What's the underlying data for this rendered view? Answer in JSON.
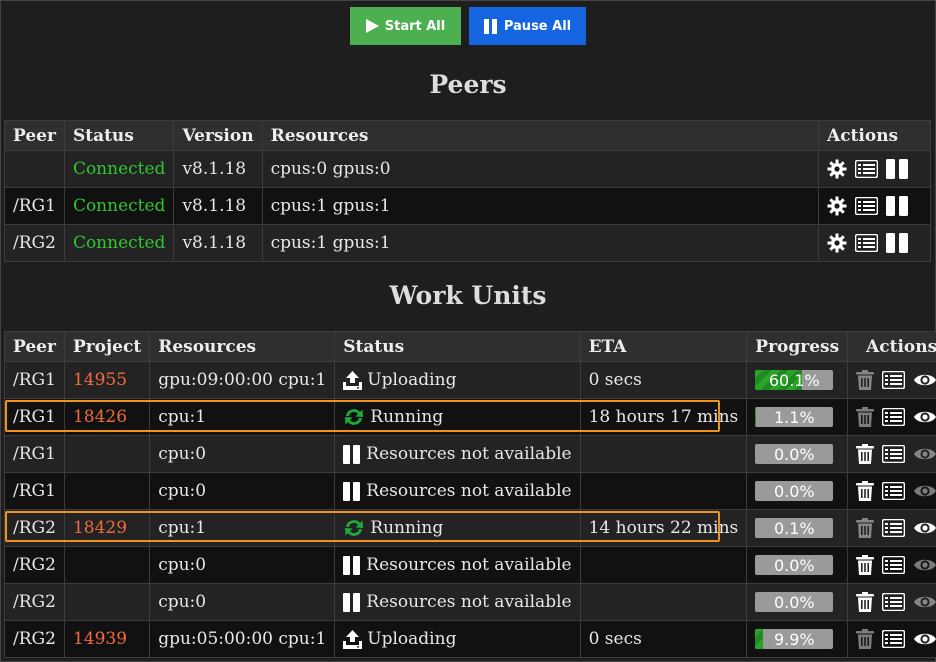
{
  "top_buttons": {
    "start_label": "Start All",
    "pause_label": "Pause All"
  },
  "peers": {
    "heading": "Peers",
    "columns": [
      "Peer",
      "Status",
      "Version",
      "Resources",
      "Actions"
    ],
    "rows": [
      {
        "peer": "",
        "status": "Connected",
        "version": "v8.1.18",
        "resources": "cpus:0 gpus:0"
      },
      {
        "peer": "/RG1",
        "status": "Connected",
        "version": "v8.1.18",
        "resources": "cpus:1 gpus:1"
      },
      {
        "peer": "/RG2",
        "status": "Connected",
        "version": "v8.1.18",
        "resources": "cpus:1 gpus:1"
      }
    ]
  },
  "work_units": {
    "heading": "Work Units",
    "columns": [
      "Peer",
      "Project",
      "Resources",
      "Status",
      "ETA",
      "Progress",
      "Actions"
    ],
    "rows": [
      {
        "peer": "/RG1",
        "project": "14955",
        "resources": "gpu:09:00:00 cpu:1",
        "status": "Uploading",
        "status_icon": "upload-icon",
        "eta": "0 secs",
        "progress": "60.1%",
        "progress_value": 60.1,
        "eye_enabled": true
      },
      {
        "peer": "/RG1",
        "project": "18426",
        "resources": "cpu:1",
        "status": "Running",
        "status_icon": "running-icon",
        "eta": "18 hours 17 mins",
        "progress": "1.1%",
        "progress_value": 1.1,
        "eye_enabled": true
      },
      {
        "peer": "/RG1",
        "project": "",
        "resources": "cpu:0",
        "status": "Resources not available",
        "status_icon": "pause-icon",
        "eta": "",
        "progress": "0.0%",
        "progress_value": 0,
        "eye_enabled": false
      },
      {
        "peer": "/RG1",
        "project": "",
        "resources": "cpu:0",
        "status": "Resources not available",
        "status_icon": "pause-icon",
        "eta": "",
        "progress": "0.0%",
        "progress_value": 0,
        "eye_enabled": false
      },
      {
        "peer": "/RG2",
        "project": "18429",
        "resources": "cpu:1",
        "status": "Running",
        "status_icon": "running-icon",
        "eta": "14 hours 22 mins",
        "progress": "0.1%",
        "progress_value": 0.1,
        "eye_enabled": true
      },
      {
        "peer": "/RG2",
        "project": "",
        "resources": "cpu:0",
        "status": "Resources not available",
        "status_icon": "pause-icon",
        "eta": "",
        "progress": "0.0%",
        "progress_value": 0,
        "eye_enabled": false
      },
      {
        "peer": "/RG2",
        "project": "",
        "resources": "cpu:0",
        "status": "Resources not available",
        "status_icon": "pause-icon",
        "eta": "",
        "progress": "0.0%",
        "progress_value": 0,
        "eye_enabled": false
      },
      {
        "peer": "/RG2",
        "project": "14939",
        "resources": "gpu:05:00:00 cpu:1",
        "status": "Uploading",
        "status_icon": "upload-icon",
        "eta": "0 secs",
        "progress": "9.9%",
        "progress_value": 9.9,
        "eye_enabled": true
      }
    ]
  },
  "colors": {
    "connected": "#2ec82e",
    "project": "#f26a3d",
    "highlight": "#f0921c",
    "start": "#4caf50",
    "pause": "#1565e0"
  }
}
